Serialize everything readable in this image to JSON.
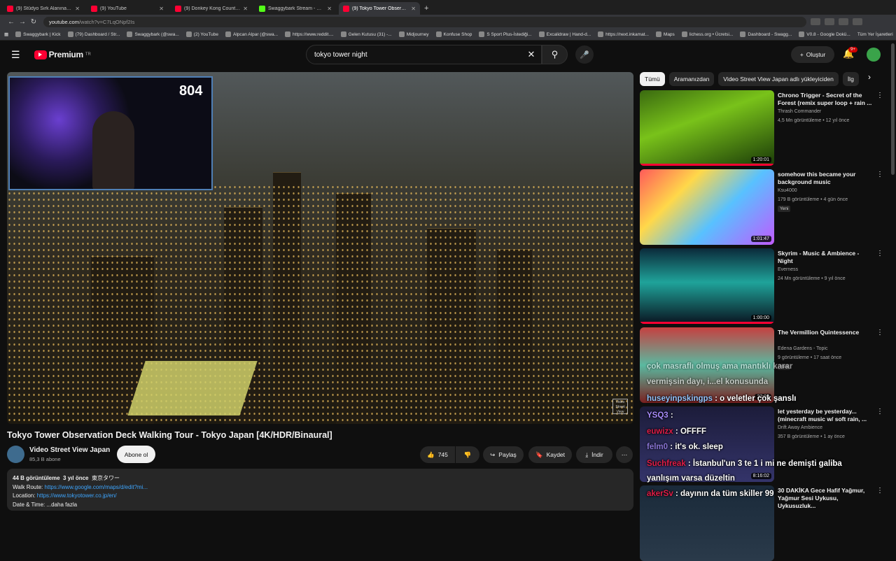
{
  "browser": {
    "tabs": [
      {
        "label": "(9) Stüdyo Sırk Alanına Döndü...",
        "favicon": "youtube"
      },
      {
        "label": "(9) YouTube",
        "favicon": "youtube"
      },
      {
        "label": "(9) Donkey Kong Country -",
        "favicon": "youtube"
      },
      {
        "label": "Swaggybark Stream - Watch Li...",
        "favicon": "kick"
      },
      {
        "label": "(9) Tokyo Tower Observatio...",
        "favicon": "youtube",
        "active": true
      }
    ],
    "url_host": "youtube.com",
    "url_path": "/watch?v=C7LqONpf2Is",
    "bookmarks": [
      "Swaggybark | Kick",
      "(79) Dashboard / Str...",
      "Swaggybark (@swa...",
      "(2) YouTube",
      "Alpcan Alpar (@swa...",
      "https://www.reddit....",
      "Gelen Kutusu (31) -...",
      "Midjourney",
      "Konfuse Shop",
      "S Sport Plus-İstediği...",
      "Excalidraw | Hand-d...",
      "https://next.inkamat...",
      "Maps",
      "lichess.org • Ücretsi...",
      "Dashboard - Swagg...",
      "V0.8 - Google Dokü..."
    ],
    "other_bookmarks": "Tüm Yer İşaretleri"
  },
  "header": {
    "logo_text": "Premium",
    "logo_region": "TR",
    "search_value": "tokyo tower night",
    "create_label": "Oluştur",
    "notif_badge": "9+"
  },
  "player": {
    "overlay_counter": "804",
    "watermark": "Video Street View"
  },
  "video": {
    "title": "Tokyo Tower Observation Deck Walking Tour - Tokyo Japan [4K/HDR/Binaural]",
    "channel": "Video Street View Japan",
    "subs": "85,3 B abone",
    "subscribe_label": "Abone ol",
    "likes": "745",
    "share_label": "Paylaş",
    "save_label": "Kaydet",
    "download_label": "İndir",
    "desc": {
      "views": "44 B görüntüleme",
      "age": "3 yıl önce",
      "tag": "東京タワー",
      "route_label": "Walk Route:",
      "route_url": "https://www.google.com/maps/d/edit?mi...",
      "loc_label": "Location:",
      "loc_url": "https://www.tokyotower.co.jp/en/",
      "date_line": "Date & Time: ...daha fazla"
    }
  },
  "chips": [
    "Tümü",
    "Aramanızdan",
    "Video Street View Japan adlı yükleyiciden",
    "İlg"
  ],
  "recommendations": [
    {
      "title": "Chrono Trigger - Secret of the Forest (remix super loop + rain ...",
      "channel": "Thrash Commander",
      "meta": "4,5 Mn görüntüleme • 12 yıl önce",
      "duration": "1:20:01",
      "badge": "",
      "progress": 1.0
    },
    {
      "title": "somehow this became your background music",
      "channel": "Ksu4000",
      "meta": "179 B görüntüleme • 4 gün önce",
      "duration": "1:01:47",
      "badge": "Yeni",
      "progress": 0
    },
    {
      "title": "Skyrim - Music & Ambience - Night",
      "channel": "Everness",
      "meta": "24 Mn görüntüleme • 9 yıl önce",
      "duration": "1:00:00",
      "badge": "",
      "progress": 1.0
    },
    {
      "title": "The Vermillion Quintessence",
      "channel": "Edena Gardens - Topic",
      "meta": "9 görüntüleme • 17 saat önce",
      "duration": "22:00",
      "badge": "Yeni",
      "progress": 0
    },
    {
      "title": "let yesterday be yesterday... (minecraft music w/ soft rain, ...",
      "channel": "Drift Away Ambience",
      "meta": "357 B görüntüleme • 1 ay önce",
      "duration": "8:16:02",
      "badge": "",
      "progress": 0
    },
    {
      "title": "30 DAKİKA Gece Hafif Yağmur, Yağmur Sesi Uykusu, Uykusuzluk...",
      "channel": "",
      "meta": "",
      "duration": "",
      "badge": "",
      "progress": 0
    }
  ],
  "chat": [
    {
      "user": "",
      "text": "çok masraflı olmuş ama mantıklı karar"
    },
    {
      "user": "",
      "text": "vermişsin dayı, i...el konusunda"
    },
    {
      "user": "huseyinpskingps",
      "text": ": o veletler çok şanslı"
    },
    {
      "user": "YSQ3",
      "text": ":"
    },
    {
      "user": "euwizx",
      "text": ": OFFFF"
    },
    {
      "user": "felm0",
      "text": ": it's ok. sleep"
    },
    {
      "user": "Suchfreak",
      "text": ": İstanbul'un 3 te 1 i mi ne demişti galiba"
    },
    {
      "user": "",
      "text": "yanlışım varsa düzeltin"
    },
    {
      "user": "akerSv",
      "text": ": dayının da tüm skiller 99"
    }
  ],
  "colors": {
    "accent": "#ff0033",
    "link": "#3ea6ff",
    "bg": "#0f0f0f"
  }
}
